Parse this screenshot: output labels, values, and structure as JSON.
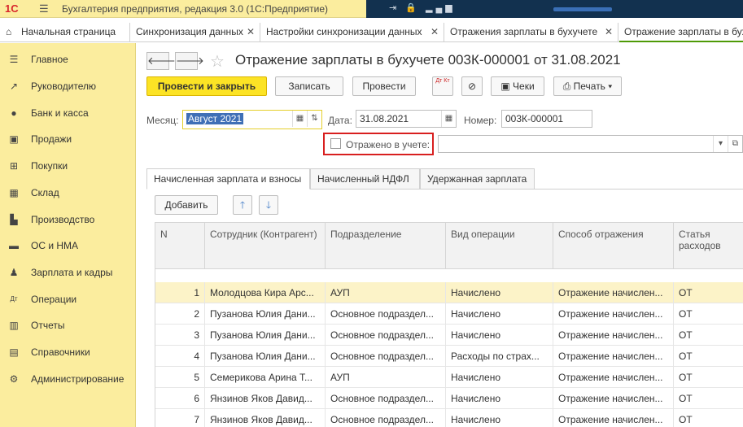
{
  "app": {
    "logo": "1С",
    "menu_icon": "hamburger-icon",
    "title": "Бухгалтерия предприятия, редакция 3.0  (1С:Предприятие)"
  },
  "tabs": {
    "home": "Начальная страница",
    "items": [
      {
        "label": "Синхронизация данных"
      },
      {
        "label": "Настройки синхронизации данных"
      },
      {
        "label": "Отражения зарплаты в бухучете"
      },
      {
        "label": "Отражение зарплаты в бухуч"
      }
    ]
  },
  "sidebar": {
    "items": [
      {
        "label": "Главное",
        "icon": "list-icon"
      },
      {
        "label": "Руководителю",
        "icon": "trend-icon"
      },
      {
        "label": "Банк и касса",
        "icon": "coin-icon"
      },
      {
        "label": "Продажи",
        "icon": "bag-icon"
      },
      {
        "label": "Покупки",
        "icon": "cart-icon"
      },
      {
        "label": "Склад",
        "icon": "warehouse-icon"
      },
      {
        "label": "Производство",
        "icon": "factory-icon"
      },
      {
        "label": "ОС и НМА",
        "icon": "truck-icon"
      },
      {
        "label": "Зарплата и кадры",
        "icon": "person-icon"
      },
      {
        "label": "Операции",
        "icon": "dt-kt-icon"
      },
      {
        "label": "Отчеты",
        "icon": "bar-chart-icon"
      },
      {
        "label": "Справочники",
        "icon": "books-icon"
      },
      {
        "label": "Администрирование",
        "icon": "gear-icon"
      }
    ]
  },
  "doc": {
    "title": "Отражение зарплаты в бухучете 003К-000001 от 31.08.2021"
  },
  "toolbar": {
    "post_close": "Провести и закрыть",
    "save": "Записать",
    "post": "Провести",
    "dtkt": "Дт Кт",
    "receipts": "Чеки",
    "print": "Печать"
  },
  "form": {
    "month_label": "Месяц:",
    "month_value": "Август 2021",
    "date_label": "Дата:",
    "date_value": "31.08.2021",
    "number_label": "Номер:",
    "number_value": "003К-000001",
    "reflected_label": "Отражено в учете:",
    "reflected_value": ""
  },
  "inner_tabs": [
    {
      "label": "Начисленная зарплата и взносы"
    },
    {
      "label": "Начисленный НДФЛ"
    },
    {
      "label": "Удержанная зарплата"
    }
  ],
  "table_toolbar": {
    "add": "Добавить"
  },
  "table": {
    "headers": [
      "N",
      "Сотрудник (Контрагент)",
      "Подразделение",
      "Вид операции",
      "Способ отражения",
      "Статья расходов"
    ],
    "rows": [
      [
        "1",
        "Молодцова Кира Арс...",
        "АУП",
        "Начислено",
        "Отражение начислен...",
        "ОТ"
      ],
      [
        "2",
        "Пузанова Юлия Дани...",
        "Основное подраздел...",
        "Начислено",
        "Отражение начислен...",
        "ОТ"
      ],
      [
        "3",
        "Пузанова Юлия Дани...",
        "Основное подраздел...",
        "Начислено",
        "Отражение начислен...",
        "ОТ"
      ],
      [
        "4",
        "Пузанова Юлия Дани...",
        "Основное подраздел...",
        "Расходы по страх...",
        "Отражение начислен...",
        "ОТ"
      ],
      [
        "5",
        "Семерикова Арина Т...",
        "АУП",
        "Начислено",
        "Отражение начислен...",
        "ОТ"
      ],
      [
        "6",
        "Янзинов Яков Давид...",
        "Основное подраздел...",
        "Начислено",
        "Отражение начислен...",
        "ОТ"
      ],
      [
        "7",
        "Янзинов Яков Давид...",
        "Основное подраздел...",
        "Начислено",
        "Отражение начислен...",
        "ОТ"
      ]
    ]
  }
}
